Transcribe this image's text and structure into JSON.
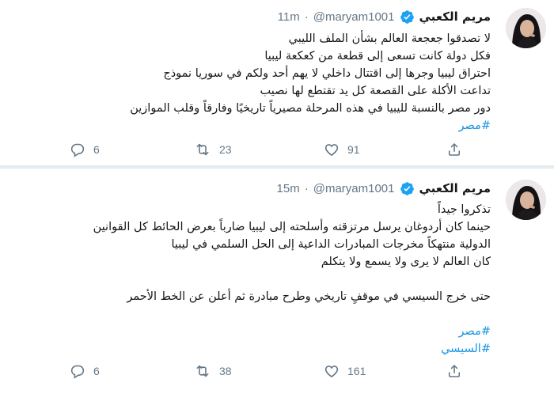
{
  "tweets": [
    {
      "author_name": "مريم الكعبي",
      "handle": "@maryam1001",
      "separator": "·",
      "time": "11m",
      "lines": [
        "لا تصدقوا جعجعة العالم بشأن الملف الليبي",
        "فكل دولة كانت تسعى إلى قطعة من كعكعة ليبيا",
        "احتراق ليبيا وجرها إلى اقتتال داخلي لا يهم أحد ولكم في سوريا نموذج",
        "تداعت الأكلة على القصعة كل يد تقتطع لها نصيب",
        "دور مصر بالنسبة لليبيا في هذه المرحلة مصيرياً تاريخيًا وفارقاً وقلب الموازين"
      ],
      "hashtags": [
        "#مصر"
      ],
      "replies": "6",
      "retweets": "23",
      "likes": "91"
    },
    {
      "author_name": "مريم الكعبي",
      "handle": "@maryam1001",
      "separator": "·",
      "time": "15m",
      "lines": [
        "تذكروا جيداً",
        "حينما كان أردوغان يرسل مرتزقته وأسلحته إلى ليبيا ضارباً بعرض الحائط كل القوانين",
        "الدولية منتهكاً مخرجات المبادرات الداعية إلى الحل السلمي في ليبيا",
        "كان العالم لا يرى ولا يسمع ولا يتكلم",
        "",
        "حتى خرج السيسي في موقفٍ تاريخي وطرح مبادرة ثم أعلن عن الخط الأحمر",
        ""
      ],
      "hashtags": [
        "#مصر",
        "#السيسي"
      ],
      "replies": "6",
      "retweets": "38",
      "likes": "161"
    }
  ],
  "colors": {
    "text": "#14171a",
    "secondary": "#657786",
    "link": "#1b95e0",
    "verified": "#1da1f2",
    "divider": "#e6ecf0"
  },
  "icons": [
    "reply-icon",
    "retweet-icon",
    "like-icon",
    "share-icon",
    "verified-badge-icon"
  ]
}
